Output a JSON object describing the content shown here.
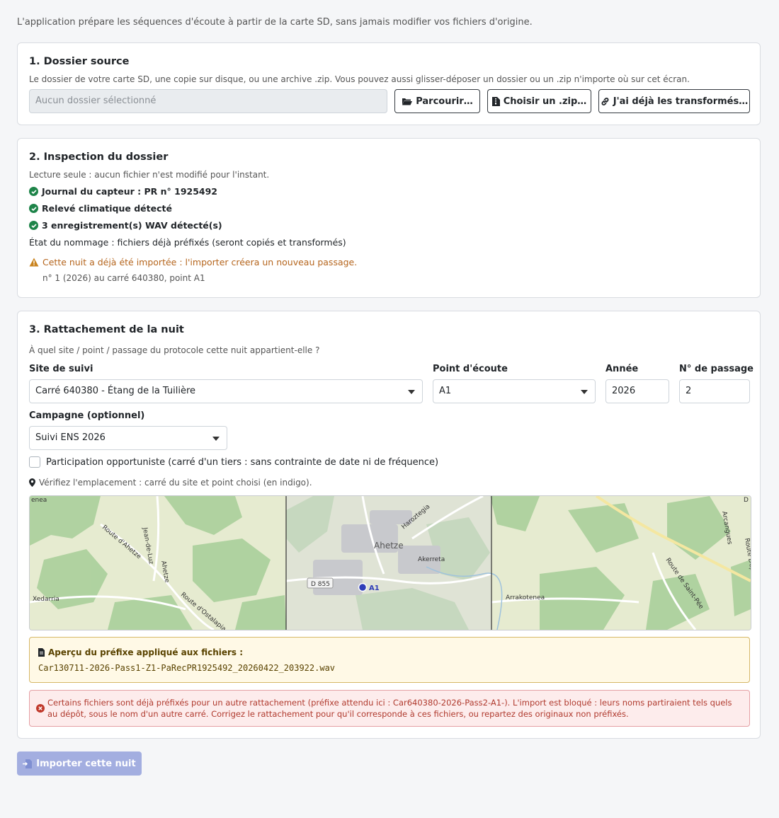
{
  "intro": "L'application prépare les séquences d'écoute à partir de la carte SD, sans jamais modifier vos fichiers d'origine.",
  "source": {
    "title": "1. Dossier source",
    "help": "Le dossier de votre carte SD, une copie sur disque, ou une archive .zip. Vous pouvez aussi glisser-déposer un dossier ou un .zip n'importe où sur cet écran.",
    "path_placeholder": "Aucun dossier sélectionné",
    "browse_label": "Parcourir…",
    "zip_label": "Choisir un .zip…",
    "already_label": "J'ai déjà les transformés…"
  },
  "inspection": {
    "title": "2. Inspection du dossier",
    "help": "Lecture seule : aucun fichier n'est modifié pour l'instant.",
    "checks": [
      "Journal du capteur : PR n° 1925492",
      "Relevé climatique détecté",
      "3 enregistrement(s) WAV détecté(s)"
    ],
    "naming_state": "État du nommage : fichiers déjà préfixés (seront copiés et transformés)",
    "warning": "Cette nuit a déjà été importée : l'importer créera un nouveau passage.",
    "warning_detail": "n° 1 (2026) au carré 640380, point A1"
  },
  "attachment": {
    "title": "3. Rattachement de la nuit",
    "help": "À quel site / point / passage du protocole cette nuit appartient-elle ?",
    "site_label": "Site de suivi",
    "site_value": "Carré 640380 - Étang de la Tuilière",
    "point_label": "Point d'écoute",
    "point_value": "A1",
    "year_label": "Année",
    "year_value": "2026",
    "passage_label": "N° de passage",
    "passage_value": "2",
    "campaign_label": "Campagne (optionnel)",
    "campaign_value": "Suivi ENS 2026",
    "opportunist_label": "Participation opportuniste (carré d'un tiers : sans contrainte de date ni de fréquence)",
    "opportunist_checked": false,
    "map_hint": "Vérifiez l'emplacement : carré du site et point choisi (en indigo).",
    "map_labels": {
      "enea": "enea",
      "jean": "Jean-de-Luz",
      "route_ahetze": "Route d'Ahetze",
      "ahetze_road": "Ahetze",
      "xedarria": "Xedarria",
      "route_ostalapia": "Route d'Ostalapia",
      "ahetze": "Ahetze",
      "haroztegia": "Haroztegia",
      "akerreta": "Akerreta",
      "d855": "D 855",
      "point": "A1",
      "arrakotenea": "Arrakotenea",
      "route_saint_pee": "Route de Saint-Pée",
      "arcangues": "Arcangues",
      "route_dep": "Route Départementale",
      "d": "D"
    },
    "preview_title": "Aperçu du préfixe appliqué aux fichiers :",
    "preview_value": "Car130711-2026-Pass1-Z1-PaRecPR1925492_20260422_203922.wav",
    "error": "Certains fichiers sont déjà préfixés pour un autre rattachement (préfixe attendu ici : Car640380-2026-Pass2-A1-). L'import est bloqué : leurs noms partiraient tels quels au dépôt, sous le nom d'un autre carré. Corrigez le rattachement pour qu'il corresponde à ces fichiers, ou repartez des originaux non préfixés."
  },
  "import_label": "Importer cette nuit",
  "colors": {
    "check": "#1e8449",
    "warning": "#b5651d",
    "error": "#c0392b",
    "point": "#2f3eb8",
    "import": "#a3aee0"
  }
}
